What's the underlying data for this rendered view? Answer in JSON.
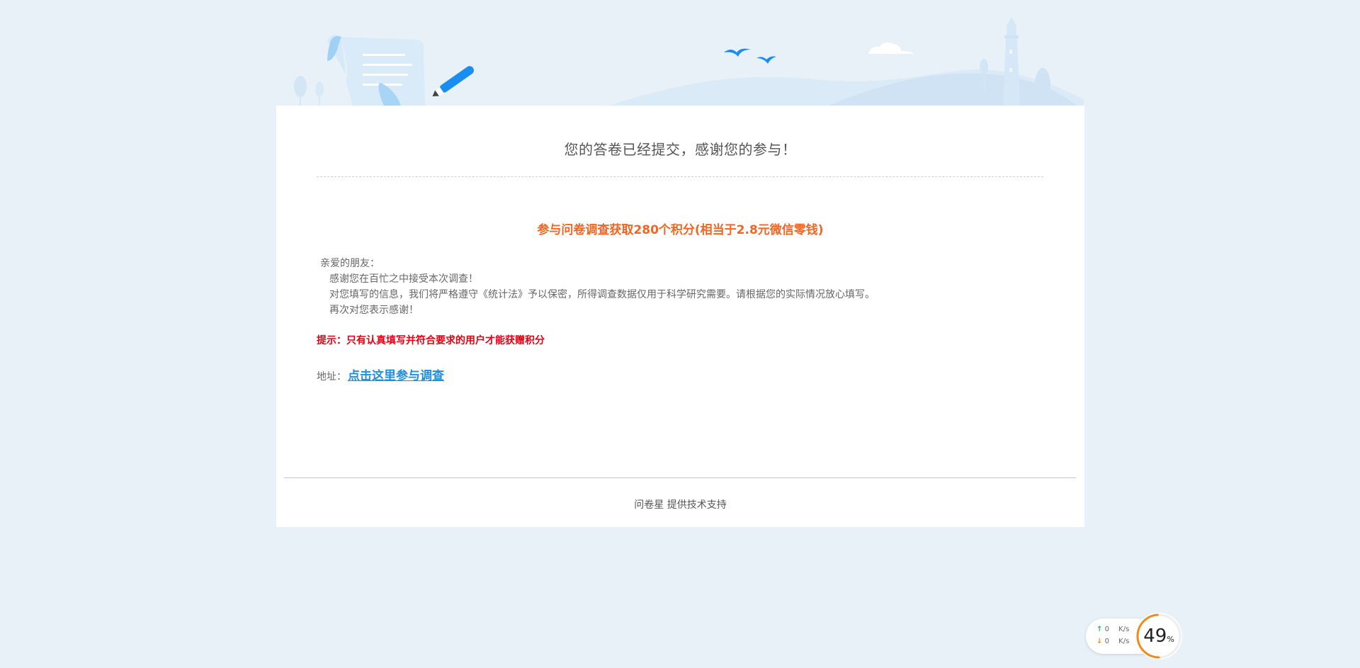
{
  "survey": {
    "title": "您的答卷已经提交，感谢您的参与！",
    "reward": "参与问卷调查获取280个积分(相当于2.8元微信零钱)",
    "letter": {
      "greeting": "亲爱的朋友：",
      "line1": "感谢您在百忙之中接受本次调查！",
      "line2": "对您填写的信息，我们将严格遵守《统计法》予以保密，所得调查数据仅用于科学研究需要。请根据您的实际情况放心填写。",
      "line3": "再次对您表示感谢！"
    },
    "tip": "提示：只有认真填写并符合要求的用户才能获赠积分",
    "address_label": "地址：",
    "address_link": "点击这里参与调查",
    "footer": "问卷星 提供技术支持"
  },
  "network_monitor": {
    "upload_value": "0",
    "upload_unit": "K/s",
    "download_value": "0",
    "download_unit": "K/s",
    "usage_value": "49",
    "usage_unit": "%",
    "usage_fraction": 0.49,
    "accent_color": "#f38b1c"
  },
  "colors": {
    "background": "#e9f1f8",
    "reward_text": "#f26522",
    "tip_text": "#e60012",
    "link": "#1e8fe0",
    "illustration_blue": "#3aa0f0"
  }
}
